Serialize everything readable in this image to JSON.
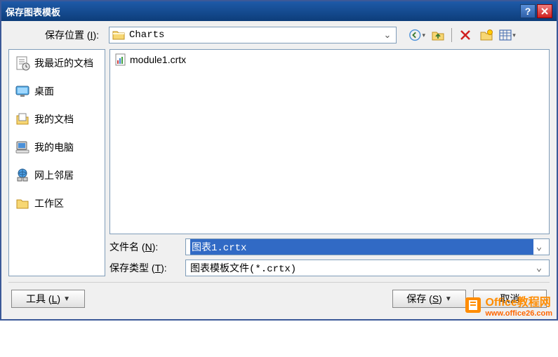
{
  "title": "保存图表模板",
  "location": {
    "label_pre": "保存位置 (",
    "label_key": "I",
    "label_post": "):",
    "value": "Charts"
  },
  "sidebar": {
    "items": [
      {
        "label": "我最近的文档"
      },
      {
        "label": "桌面"
      },
      {
        "label": "我的文档"
      },
      {
        "label": "我的电脑"
      },
      {
        "label": "网上邻居"
      },
      {
        "label": "工作区"
      }
    ]
  },
  "files": [
    {
      "name": "module1.crtx"
    }
  ],
  "filename": {
    "label_pre": "文件名 (",
    "label_key": "N",
    "label_post": "):",
    "value": "图表1.crtx"
  },
  "filetype": {
    "label_pre": "保存类型 (",
    "label_key": "T",
    "label_post": "):",
    "value": "图表模板文件(*.crtx)"
  },
  "buttons": {
    "tools_pre": "工具 (",
    "tools_key": "L",
    "tools_post": ")",
    "save_pre": "保存 (",
    "save_key": "S",
    "save_post": ")",
    "cancel": "取消"
  },
  "watermark": {
    "line1": "Office教程网",
    "line2": "www.office26.com"
  }
}
